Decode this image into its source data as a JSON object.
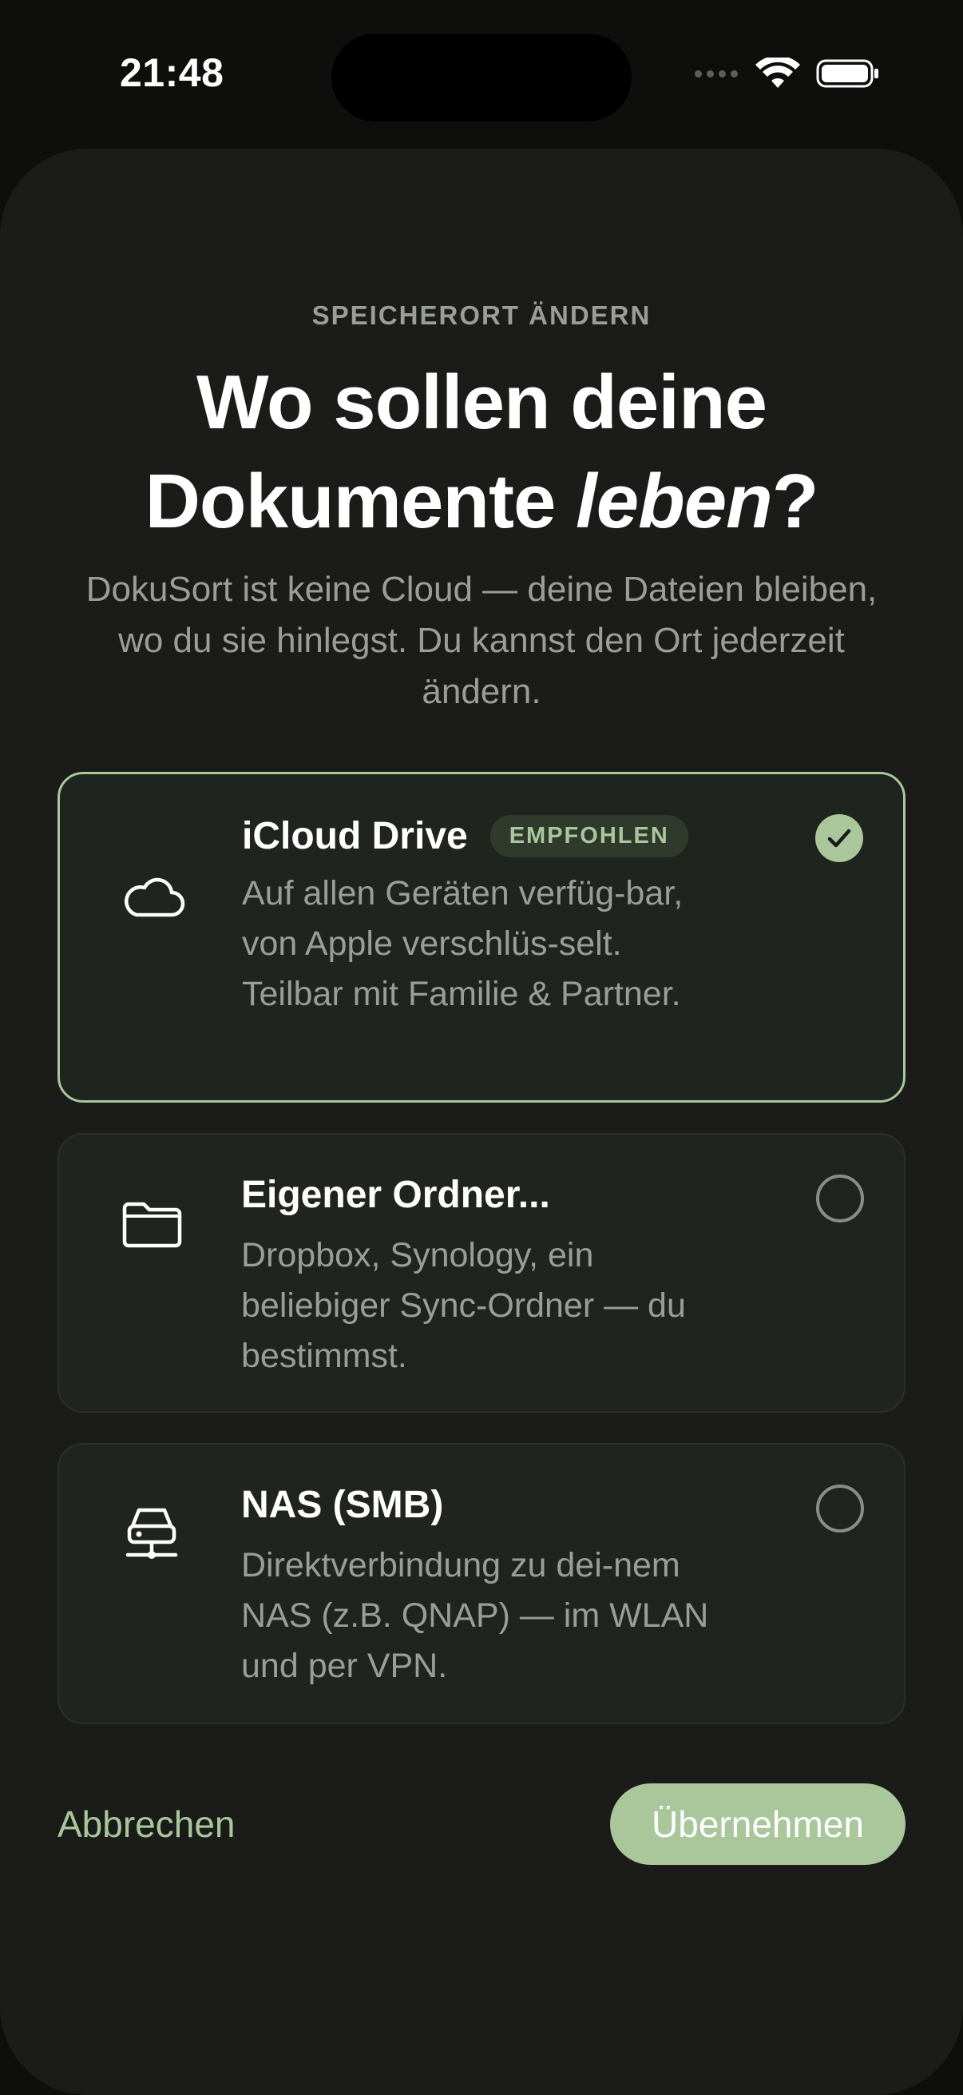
{
  "status_bar": {
    "time": "21:48"
  },
  "sheet": {
    "eyebrow": "SPEICHERORT ÄNDERN",
    "title_line1": "Wo sollen deine",
    "title_line2_plain": "Dokumente ",
    "title_line2_italic": "leben",
    "title_line2_end": "?",
    "subtitle": "DokuSort ist keine Cloud — deine Dateien bleiben, wo du sie hinlegst. Du kannst den Ort jederzeit ändern."
  },
  "options": [
    {
      "title": "iCloud Drive",
      "badge": "EMPFOHLEN",
      "description": "Auf allen Geräten verfüg-bar, von Apple verschlüs-selt. Teilbar mit Familie & Partner.",
      "icon": "cloud-icon",
      "selected": true
    },
    {
      "title": "Eigener Ordner...",
      "description": "Dropbox, Synology, ein beliebiger Sync-Ordner — du bestimmst.",
      "icon": "folder-icon",
      "selected": false
    },
    {
      "title": "NAS (SMB)",
      "description": "Direktverbindung zu dei-nem NAS (z.B. QNAP) — im WLAN und per VPN.",
      "icon": "server-icon",
      "selected": false
    }
  ],
  "footer": {
    "cancel_label": "Abbrechen",
    "apply_label": "Übernehmen"
  },
  "colors": {
    "accent": "#a9c79b",
    "background": "#1b1c1a",
    "card": "#20241e"
  }
}
